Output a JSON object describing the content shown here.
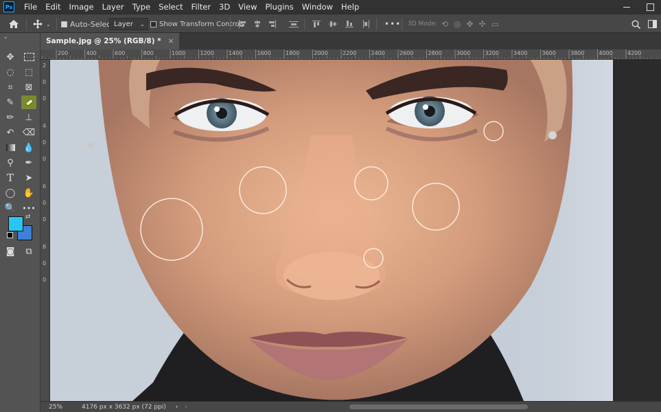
{
  "menu": {
    "logo": "Ps",
    "items": [
      "File",
      "Edit",
      "Image",
      "Layer",
      "Type",
      "Select",
      "Filter",
      "3D",
      "View",
      "Plugins",
      "Window",
      "Help"
    ]
  },
  "options": {
    "auto_select_label": "Auto-Select:",
    "auto_select_value": "Layer",
    "show_transform_label": "Show Transform Controls",
    "mode_3d_label": "3D Mode:",
    "more_label": "•••"
  },
  "document": {
    "tab_title": "Sample.jpg @ 25% (RGB/8) *",
    "close_glyph": "×"
  },
  "rulers": {
    "horizontal": [
      "200",
      "400",
      "600",
      "800",
      "1000",
      "1200",
      "1400",
      "1600",
      "1800",
      "2000",
      "2200",
      "2400",
      "2600",
      "2800",
      "3000",
      "3200",
      "3400",
      "3600",
      "3800",
      "4000",
      "4200"
    ],
    "vertical": [
      "2",
      "0",
      "0",
      "4",
      "0",
      "0",
      "6",
      "0",
      "0",
      "8",
      "0",
      "0"
    ]
  },
  "status": {
    "zoom": "25%",
    "dimensions": "4176 px x 3632 px (72 ppi)"
  },
  "colors": {
    "foreground": "#29c6f2",
    "background": "#3f7fd6",
    "active_tool": "#7b8a31"
  },
  "icons": {
    "home": "home-icon",
    "move": "move-icon",
    "healing": "spot-healing-brush-icon"
  }
}
